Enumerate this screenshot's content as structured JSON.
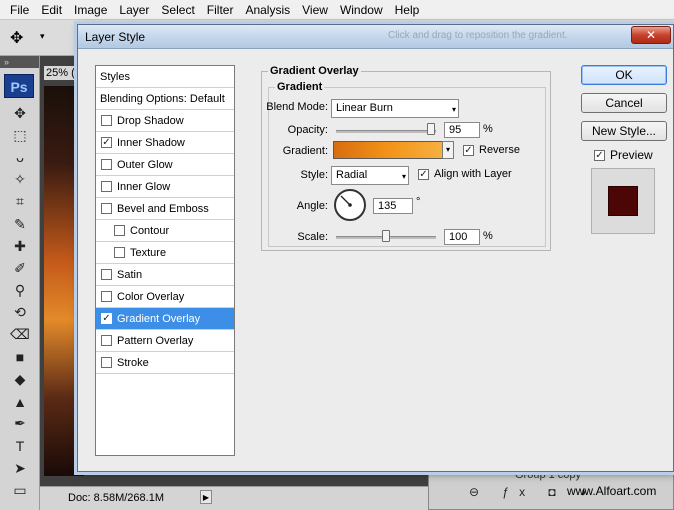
{
  "menu": [
    "File",
    "Edit",
    "Image",
    "Layer",
    "Select",
    "Filter",
    "Analysis",
    "View",
    "Window",
    "Help"
  ],
  "optionsbar": {
    "tool_icon": "move-tool-icon",
    "caret": "▾"
  },
  "tools": {
    "grip": "»",
    "logo": "Ps",
    "icons": [
      "✥",
      "⬚",
      "ᴗ",
      "✧",
      "⌗",
      "✎",
      "✚",
      "✐",
      "⚲",
      "⟲",
      "⌫",
      "■",
      "◆",
      "▲",
      "✒",
      "T",
      "➤",
      "▭"
    ]
  },
  "canvas": {
    "zoom": "25% ("
  },
  "statusbar": {
    "doc": "Doc: 8.58M/268.1M",
    "arrow": "▶"
  },
  "layers": {
    "group": "Group 1 copy",
    "icons": "⊖ ƒx ◘ ◑",
    "watermark": "www.Alfoart.com"
  },
  "dialog": {
    "title": "Layer Style",
    "hint": "Click and drag to reposition the gradient.",
    "close": "✕",
    "styles_header": "Styles",
    "blending": "Blending Options: Default",
    "styles": [
      {
        "label": "Drop Shadow",
        "checked": false,
        "indent": false,
        "selected": false
      },
      {
        "label": "Inner Shadow",
        "checked": true,
        "indent": false,
        "selected": false
      },
      {
        "label": "Outer Glow",
        "checked": false,
        "indent": false,
        "selected": false
      },
      {
        "label": "Inner Glow",
        "checked": false,
        "indent": false,
        "selected": false
      },
      {
        "label": "Bevel and Emboss",
        "checked": false,
        "indent": false,
        "selected": false
      },
      {
        "label": "Contour",
        "checked": false,
        "indent": true,
        "selected": false
      },
      {
        "label": "Texture",
        "checked": false,
        "indent": true,
        "selected": false
      },
      {
        "label": "Satin",
        "checked": false,
        "indent": false,
        "selected": false
      },
      {
        "label": "Color Overlay",
        "checked": false,
        "indent": false,
        "selected": false
      },
      {
        "label": "Gradient Overlay",
        "checked": true,
        "indent": false,
        "selected": true
      },
      {
        "label": "Pattern Overlay",
        "checked": false,
        "indent": false,
        "selected": false
      },
      {
        "label": "Stroke",
        "checked": false,
        "indent": false,
        "selected": false
      }
    ],
    "panel_title": "Gradient Overlay",
    "sub_title": "Gradient",
    "blend_mode_label": "Blend Mode:",
    "blend_mode_value": "Linear Burn",
    "opacity_label": "Opacity:",
    "opacity_value": "95",
    "opacity_unit": "%",
    "opacity_fraction": 0.95,
    "gradient_label": "Gradient:",
    "reverse_label": "Reverse",
    "reverse_checked": true,
    "style_label": "Style:",
    "style_value": "Radial",
    "align_label": "Align with Layer",
    "align_checked": true,
    "angle_label": "Angle:",
    "angle_value": "135",
    "angle_unit": "°",
    "scale_label": "Scale:",
    "scale_value": "100",
    "scale_unit": "%",
    "scale_fraction": 0.5,
    "ok": "OK",
    "cancel": "Cancel",
    "new_style": "New Style...",
    "preview_label": "Preview",
    "preview_checked": true,
    "check_mark": "✓",
    "dropdown_caret": "▾",
    "gradient_caret": "▾"
  },
  "colors": {
    "accent": "#3d8ee6",
    "preview_swatch": "#4c0606",
    "gradient_start": "#d86d0e",
    "gradient_end": "#f6b040"
  }
}
